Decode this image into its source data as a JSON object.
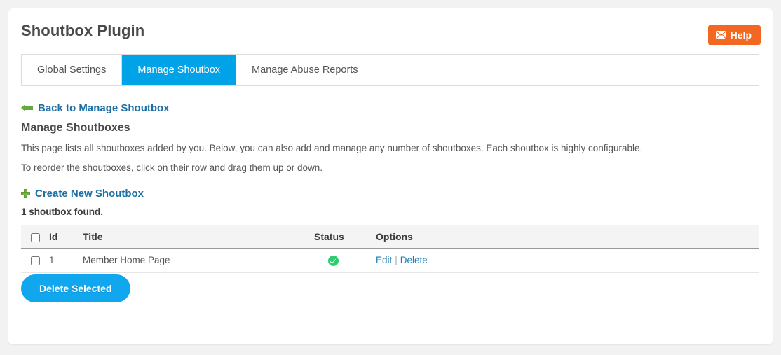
{
  "header": {
    "title": "Shoutbox Plugin",
    "help_label": "Help",
    "help_icon": "mail-icon",
    "help_color": "#f26722"
  },
  "tabs": [
    {
      "label": "Global Settings",
      "active": false
    },
    {
      "label": "Manage Shoutbox",
      "active": true
    },
    {
      "label": "Manage Abuse Reports",
      "active": false
    }
  ],
  "tabs_active_color": "#00a2e8",
  "back_link": {
    "label": "Back to Manage Shoutbox",
    "icon": "arrow-left-icon",
    "icon_color": "#63a840"
  },
  "content": {
    "heading": "Manage Shoutboxes",
    "description_line_1": "This page lists all shoutboxes added by you. Below, you can also add and manage any number of shoutboxes. Each shoutbox is highly configurable.",
    "description_line_2": "To reorder the shoutboxes, click on their row and drag them up or down.",
    "create_link": "Create New Shoutbox",
    "create_icon": "plus-icon",
    "create_icon_color": "#79b443",
    "found_count_text": "1 shoutbox found."
  },
  "table": {
    "columns": [
      "",
      "Id",
      "Title",
      "Status",
      "Options"
    ],
    "rows": [
      {
        "id": "1",
        "title": "Member Home Page",
        "status_icon": "check-circle-icon",
        "status_color": "#2ecc71",
        "edit_label": "Edit",
        "separator": "|",
        "delete_label": "Delete"
      }
    ]
  },
  "footer": {
    "delete_selected_label": "Delete Selected",
    "delete_selected_color": "#11a7ef"
  }
}
